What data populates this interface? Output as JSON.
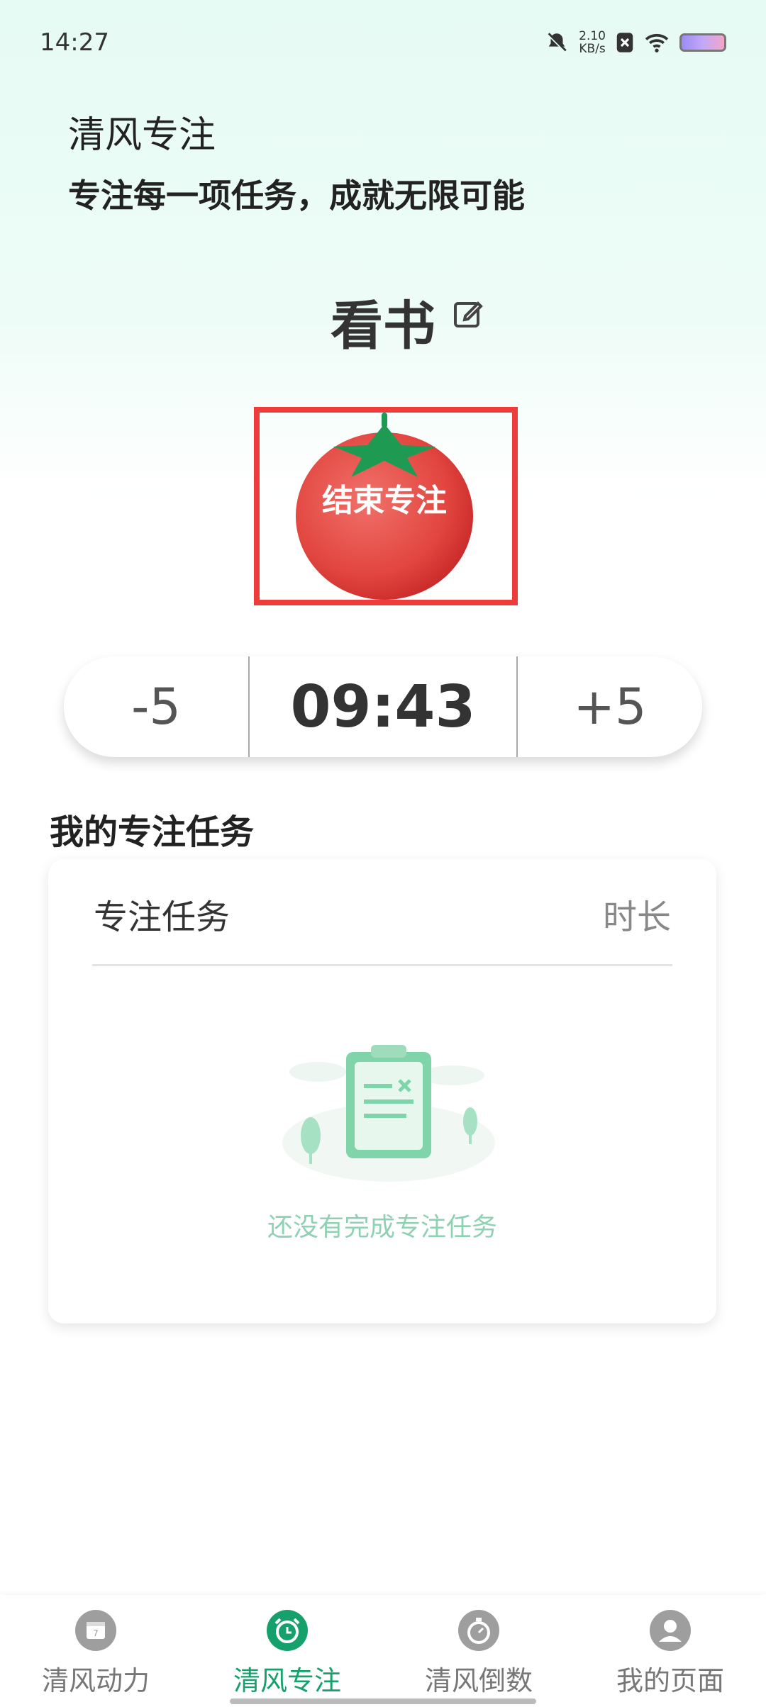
{
  "status_bar": {
    "time": "14:27",
    "net_speed_value": "2.10",
    "net_speed_unit": "KB/s",
    "icons": [
      "bell-mute-icon",
      "sim-x-icon",
      "wifi-icon",
      "battery-icon"
    ]
  },
  "header": {
    "title": "清风专注",
    "subtitle": "专注每一项任务，成就无限可能"
  },
  "focus": {
    "task_name": "看书",
    "end_button_label": "结束专注",
    "timer": {
      "minus_label": "-5",
      "display": "09:43",
      "plus_label": "+5"
    }
  },
  "tasks_section": {
    "title": "我的专注任务",
    "col_task": "专注任务",
    "col_duration": "时长",
    "empty_text": "还没有完成专注任务"
  },
  "tabbar": {
    "items": [
      {
        "label": "清风动力",
        "icon": "calendar-icon",
        "active": false
      },
      {
        "label": "清风专注",
        "icon": "alarm-clock-icon",
        "active": true
      },
      {
        "label": "清风倒数",
        "icon": "stopwatch-icon",
        "active": false
      },
      {
        "label": "我的页面",
        "icon": "user-icon",
        "active": false
      }
    ]
  },
  "colors": {
    "accent": "#16a06b",
    "tomato_red": "#e2453f",
    "highlight_border": "#ee3b3b"
  }
}
